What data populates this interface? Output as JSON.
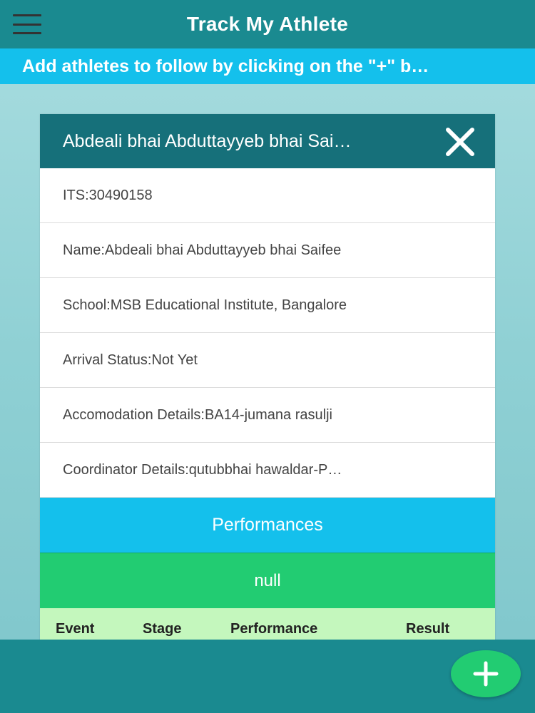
{
  "header": {
    "title": "Track My Athlete",
    "menu_icon": "hamburger-menu-icon"
  },
  "banner": {
    "text": "Add athletes to follow by clicking on the \"+\" b…"
  },
  "athlete_card": {
    "title": "Abdeali bhai Abduttayyeb bhai Sai…",
    "close_icon": "close-icon",
    "details": [
      "ITS:30490158",
      "Name:Abdeali bhai Abduttayyeb bhai Saifee",
      "School:MSB Educational Institute, Bangalore",
      "Arrival Status:Not Yet",
      "Accomodation Details:BA14-jumana rasulji",
      "Coordinator Details:qutubbhai hawaldar-P…"
    ],
    "performances_label": "Performances",
    "status_value": "null",
    "table_headers": [
      "Event",
      "Stage",
      "Performance",
      "Result"
    ]
  },
  "fab": {
    "icon": "plus-icon",
    "label": "+"
  },
  "colors": {
    "top_bar": "#1a8a90",
    "banner": "#14c0ec",
    "card_header": "#16707a",
    "performances": "#14c0ec",
    "null_bar": "#22cc72",
    "table_header": "#c4f7bd",
    "fab": "#22cc72"
  }
}
